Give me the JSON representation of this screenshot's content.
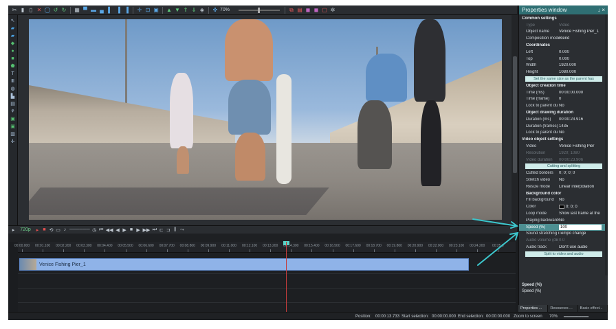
{
  "toolbar": {
    "zoom": "70%",
    "icons": [
      "scissors-icon",
      "delete-icon",
      "copy-icon",
      "close-icon",
      "circle-icon",
      "undo-icon",
      "redo-icon",
      "grid-icon",
      "align-top-icon",
      "align-middle-icon",
      "align-bottom-icon",
      "align-left-icon",
      "align-center-icon",
      "align-right-icon",
      "move-icon",
      "crop-icon",
      "fit-icon",
      "arrow-up-icon",
      "arrow-down-icon",
      "arrow-up2-icon",
      "arrow-down2-icon",
      "layers-icon",
      "target-icon"
    ]
  },
  "transport": {
    "resolution": "720p"
  },
  "ruler": {
    "ticks": [
      "00:00.000",
      "00:01.100",
      "00:02.200",
      "00:03.300",
      "00:04.400",
      "00:05.500",
      "00:06.600",
      "00:07.700",
      "00:08.800",
      "00:09.900",
      "00:11.000",
      "00:12.100",
      "00:13.200",
      "00:14.300",
      "00:15.400",
      "00:16.500",
      "00:17.600",
      "00:18.700",
      "00:19.800",
      "00:20.900",
      "00:22.000",
      "00:23.100",
      "00:24.200",
      "00:25.3"
    ]
  },
  "timeline": {
    "clip_label": "Venice Fishing Pier_1"
  },
  "properties": {
    "title": "Properties window",
    "pin": "↓ ×",
    "rows": [
      {
        "t": "sec",
        "k": "Common settings"
      },
      {
        "t": "dim",
        "k": "Type",
        "v": "Video"
      },
      {
        "t": "row",
        "k": "Object name",
        "v": "Venice Fishing Pier_1"
      },
      {
        "t": "row",
        "k": "Composition mode",
        "v": "Blend"
      },
      {
        "t": "sub",
        "k": "Coordinates"
      },
      {
        "t": "row",
        "k": "Left",
        "v": "0.000"
      },
      {
        "t": "row",
        "k": "Top",
        "v": "0.000"
      },
      {
        "t": "row",
        "k": "Width",
        "v": "1920.000"
      },
      {
        "t": "row",
        "k": "Height",
        "v": "1080.000"
      },
      {
        "t": "btn",
        "k": "Set the same size as the parent has"
      },
      {
        "t": "sub",
        "k": "Object creation time"
      },
      {
        "t": "row",
        "k": "Time (ms)",
        "v": "00:00:00.000"
      },
      {
        "t": "row",
        "k": "Time (frame)",
        "v": "0"
      },
      {
        "t": "row",
        "k": "Lock to parent du",
        "v": "No"
      },
      {
        "t": "sub",
        "k": "Object drawing duration"
      },
      {
        "t": "row",
        "k": "Duration (ms)",
        "v": "00:00:23.916"
      },
      {
        "t": "row",
        "k": "Duration (frames)",
        "v": "1435"
      },
      {
        "t": "row",
        "k": "Lock to parent du",
        "v": "No"
      },
      {
        "t": "sec",
        "k": "Video object settings"
      },
      {
        "t": "row",
        "k": "Video",
        "v": "Venice Fishing Pier"
      },
      {
        "t": "dim",
        "k": "Resolution",
        "v": "1920; 1080"
      },
      {
        "t": "dim",
        "k": "Video duration",
        "v": "00:00:23.906"
      },
      {
        "t": "btn",
        "k": "Cutting and splitting"
      },
      {
        "t": "row",
        "k": "Cutted borders",
        "v": "0; 0; 0; 0"
      },
      {
        "t": "row",
        "k": "Stretch video",
        "v": "No"
      },
      {
        "t": "row",
        "k": "Resize mode",
        "v": "Linear interpolation"
      },
      {
        "t": "sub",
        "k": "Background color"
      },
      {
        "t": "row",
        "k": "Fill background",
        "v": "No"
      },
      {
        "t": "color",
        "k": "Color",
        "v": "0; 0; 0"
      },
      {
        "t": "row",
        "k": "Loop mode",
        "v": "Show last frame at the"
      },
      {
        "t": "row",
        "k": "Playing backwards",
        "v": "No"
      },
      {
        "t": "hl",
        "k": "Speed (%)",
        "v": "100"
      },
      {
        "t": "row",
        "k": "Sound stretching m",
        "v": "Tempo change"
      },
      {
        "t": "dim",
        "k": "Audio volume (dB)",
        "v": "0.0"
      },
      {
        "t": "row",
        "k": "Audio track",
        "v": "Don't use audio"
      },
      {
        "t": "btn",
        "k": "Split to video and audio"
      }
    ],
    "desc_title": "Speed (%)",
    "desc_text": "Speed (%)",
    "tabs": [
      "Properties ...",
      "Resources ...",
      "Basic effect..."
    ]
  },
  "status": {
    "position_label": "Position:",
    "position": "00:00:13.733",
    "start_label": "Start selection:",
    "start": "00:00:00.000",
    "end_label": "End selection:",
    "end": "00:00:00.000",
    "zoom_label": "Zoom to screen",
    "zoom": "70%"
  },
  "colors": {
    "accent": "#3cc6cc",
    "playhead": "#c43c3c",
    "clip": "#8fb3e8",
    "title": "#2f6f73"
  }
}
